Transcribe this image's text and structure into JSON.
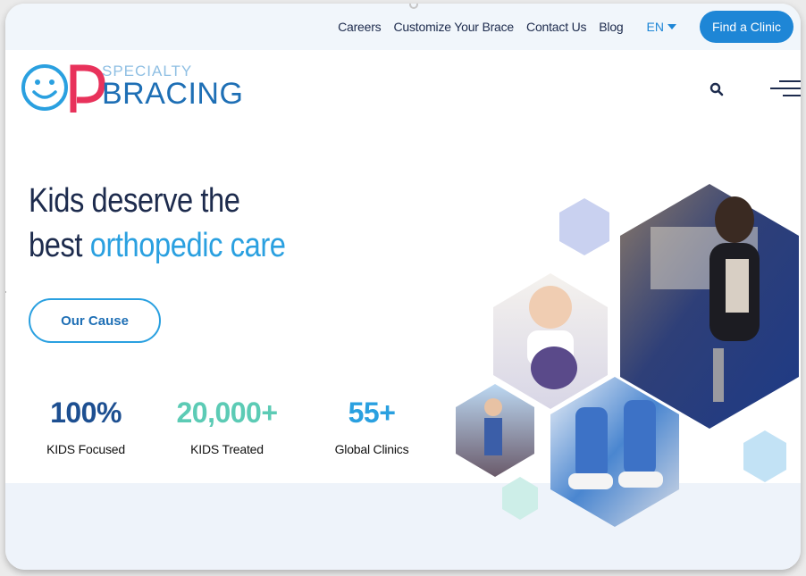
{
  "nav": {
    "links": [
      "Careers",
      "Customize Your Brace",
      "Contact Us",
      "Blog"
    ],
    "language": "EN",
    "cta": "Find a Clinic"
  },
  "logo": {
    "line1": "SPECIALTY",
    "line2": "BRACING"
  },
  "hero": {
    "title_line1": "Kids deserve the",
    "title_line2_plain": "best",
    "title_line2_accent": "orthopedic care",
    "button": "Our Cause"
  },
  "stats": [
    {
      "value": "100%",
      "label": "KIDS Focused",
      "color": "#1d4f91"
    },
    {
      "value": "20,000+",
      "label": "KIDS Treated",
      "color": "#5ccbb5"
    },
    {
      "value": "55+",
      "label": "Global Clinics",
      "color": "#2aa0e0"
    }
  ],
  "colors": {
    "brand_blue": "#1e86d6",
    "navy": "#1d2b4d",
    "accent": "#2aa0e0",
    "teal": "#5ccbb5",
    "hex_lavender": "#c9d1f0",
    "hex_lightblue": "#c2e2f5",
    "hex_mint": "#cdeee8"
  },
  "icons": [
    "smiley-logo-icon",
    "search-icon",
    "hamburger-menu-icon",
    "chevron-down-icon",
    "chevron-left-icon"
  ]
}
